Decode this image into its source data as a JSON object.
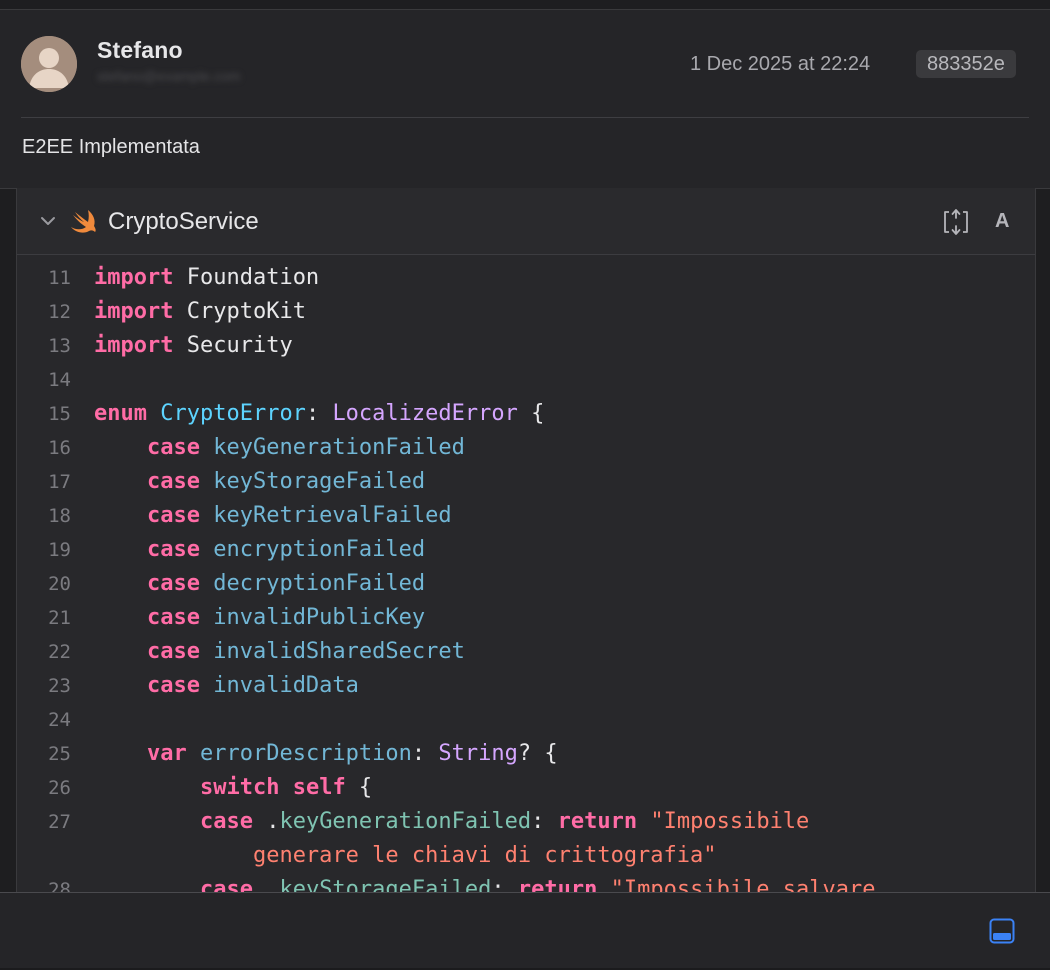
{
  "commit": {
    "author": "Stefano",
    "email": "stefano@example.com",
    "date": "1 Dec 2025 at 22:24",
    "hash": "883352e",
    "message": "E2EE Implementata"
  },
  "file": {
    "name": "CryptoService",
    "icon": "swift-icon"
  },
  "colors": {
    "keyword": "#ff6ca6",
    "type": "#d5a6ff",
    "declaration": "#5dd4ff",
    "case_name": "#72b7d6",
    "member": "#7fc4b2",
    "string": "#ff8170",
    "accent": "#3b82f6"
  },
  "code_lines": [
    {
      "n": "11",
      "parts": [
        [
          "kw",
          "import"
        ],
        [
          "pl",
          " Foundation"
        ]
      ]
    },
    {
      "n": "12",
      "parts": [
        [
          "kw",
          "import"
        ],
        [
          "pl",
          " CryptoKit"
        ]
      ]
    },
    {
      "n": "13",
      "parts": [
        [
          "kw",
          "import"
        ],
        [
          "pl",
          " Security"
        ]
      ]
    },
    {
      "n": "14",
      "parts": []
    },
    {
      "n": "15",
      "parts": [
        [
          "kw",
          "enum"
        ],
        [
          "pl",
          " "
        ],
        [
          "dc",
          "CryptoError"
        ],
        [
          "pl",
          ": "
        ],
        [
          "tp",
          "LocalizedError"
        ],
        [
          "pl",
          " {"
        ]
      ]
    },
    {
      "n": "16",
      "parts": [
        [
          "pl",
          "    "
        ],
        [
          "kw",
          "case"
        ],
        [
          "pl",
          " "
        ],
        [
          "cs",
          "keyGenerationFailed"
        ]
      ]
    },
    {
      "n": "17",
      "parts": [
        [
          "pl",
          "    "
        ],
        [
          "kw",
          "case"
        ],
        [
          "pl",
          " "
        ],
        [
          "cs",
          "keyStorageFailed"
        ]
      ]
    },
    {
      "n": "18",
      "parts": [
        [
          "pl",
          "    "
        ],
        [
          "kw",
          "case"
        ],
        [
          "pl",
          " "
        ],
        [
          "cs",
          "keyRetrievalFailed"
        ]
      ]
    },
    {
      "n": "19",
      "parts": [
        [
          "pl",
          "    "
        ],
        [
          "kw",
          "case"
        ],
        [
          "pl",
          " "
        ],
        [
          "cs",
          "encryptionFailed"
        ]
      ]
    },
    {
      "n": "20",
      "parts": [
        [
          "pl",
          "    "
        ],
        [
          "kw",
          "case"
        ],
        [
          "pl",
          " "
        ],
        [
          "cs",
          "decryptionFailed"
        ]
      ]
    },
    {
      "n": "21",
      "parts": [
        [
          "pl",
          "    "
        ],
        [
          "kw",
          "case"
        ],
        [
          "pl",
          " "
        ],
        [
          "cs",
          "invalidPublicKey"
        ]
      ]
    },
    {
      "n": "22",
      "parts": [
        [
          "pl",
          "    "
        ],
        [
          "kw",
          "case"
        ],
        [
          "pl",
          " "
        ],
        [
          "cs",
          "invalidSharedSecret"
        ]
      ]
    },
    {
      "n": "23",
      "parts": [
        [
          "pl",
          "    "
        ],
        [
          "kw",
          "case"
        ],
        [
          "pl",
          " "
        ],
        [
          "cs",
          "invalidData"
        ]
      ]
    },
    {
      "n": "24",
      "parts": []
    },
    {
      "n": "25",
      "parts": [
        [
          "pl",
          "    "
        ],
        [
          "kw",
          "var"
        ],
        [
          "pl",
          " "
        ],
        [
          "cs",
          "errorDescription"
        ],
        [
          "pl",
          ": "
        ],
        [
          "tp",
          "String"
        ],
        [
          "pl",
          "? {"
        ]
      ]
    },
    {
      "n": "26",
      "parts": [
        [
          "pl",
          "        "
        ],
        [
          "kw",
          "switch"
        ],
        [
          "pl",
          " "
        ],
        [
          "kw",
          "self"
        ],
        [
          "pl",
          " {"
        ]
      ]
    },
    {
      "n": "27",
      "parts": [
        [
          "pl",
          "        "
        ],
        [
          "kw",
          "case"
        ],
        [
          "pl",
          " ."
        ],
        [
          "mb",
          "keyGenerationFailed"
        ],
        [
          "pl",
          ": "
        ],
        [
          "kw",
          "return"
        ],
        [
          "pl",
          " "
        ],
        [
          "st",
          "\"Impossibile"
        ]
      ]
    },
    {
      "n": "",
      "parts": [
        [
          "pl",
          "            "
        ],
        [
          "st",
          "generare le chiavi di crittografia\""
        ]
      ]
    },
    {
      "n": "28",
      "parts": [
        [
          "pl",
          "        "
        ],
        [
          "kw",
          "case"
        ],
        [
          "pl",
          " ."
        ],
        [
          "mb",
          "keyStorageFailed"
        ],
        [
          "pl",
          ": "
        ],
        [
          "kw",
          "return"
        ],
        [
          "pl",
          " "
        ],
        [
          "st",
          "\"Impossibile salvare"
        ]
      ]
    }
  ]
}
